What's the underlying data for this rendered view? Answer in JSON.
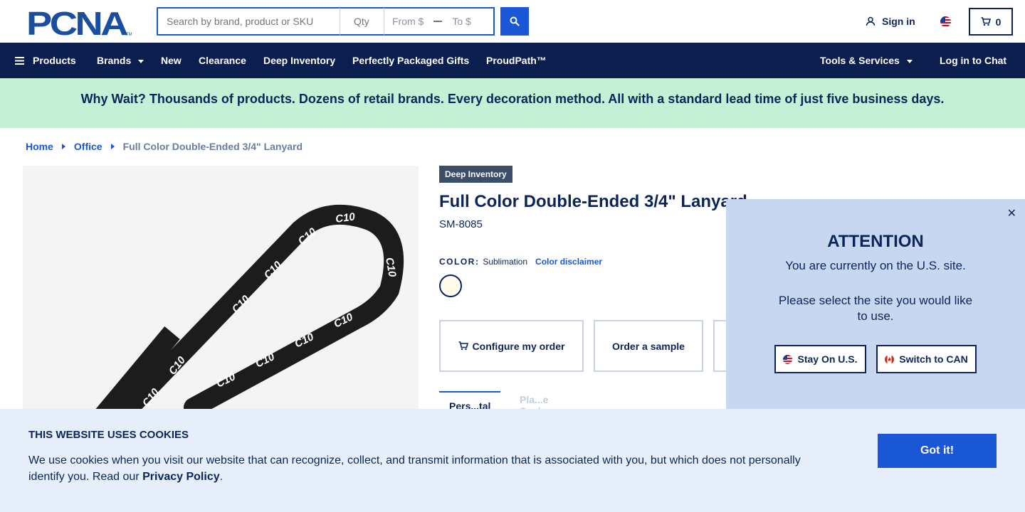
{
  "header": {
    "logo_text": "PCNA",
    "search_placeholder": "Search by brand, product or SKU",
    "qty_placeholder": "Qty",
    "price_from": "From $",
    "price_to": "To $",
    "signin_label": "Sign in",
    "cart_count": "0"
  },
  "nav": {
    "products": "Products",
    "brands": "Brands",
    "new": "New",
    "clearance": "Clearance",
    "deep_inventory": "Deep Inventory",
    "gifts": "Perfectly Packaged Gifts",
    "proudpath": "ProudPath™",
    "tools": "Tools & Services",
    "chat": "Log in to Chat"
  },
  "promo": {
    "text": "Why Wait? Thousands of products. Dozens of retail brands. Every decoration method. All with a standard lead time of just five business days."
  },
  "breadcrumb": {
    "home": "Home",
    "office": "Office",
    "current": "Full Color Double-Ended 3/4\" Lanyard"
  },
  "product": {
    "badge": "Deep Inventory",
    "title": "Full Color Double-Ended 3/4\" Lanyard",
    "sku": "SM-8085",
    "color_label": "COLOR:",
    "color_value": "Sublimation",
    "color_disclaimer": "Color disclaimer",
    "lanyard_print": "C10",
    "configure_label": "Configure my order",
    "sample_label": "Order a sample",
    "tab_active": "Pers...tal",
    "tab_second": "Pla...e S...d"
  },
  "popup": {
    "heading": "ATTENTION",
    "line1": "You are currently on the U.S. site.",
    "line2": "Please select the site you would like to use.",
    "stay_label": "Stay On U.S.",
    "switch_label": "Switch to CAN"
  },
  "cookie": {
    "heading": "THIS WEBSITE USES COOKIES",
    "text": "We use cookies when you visit our website that can recognize, collect, and transmit information that is associated with you, but which does not personally identify you. Read our ",
    "link": "Privacy Policy",
    "end": ".",
    "button": "Got it!"
  },
  "colors": {
    "navy": "#0b1f4e",
    "accent_blue": "#1a57d6",
    "promo_green": "#c4f0d6",
    "popup_bg": "#c7d7ef",
    "cookie_bg": "#e6eff9"
  }
}
